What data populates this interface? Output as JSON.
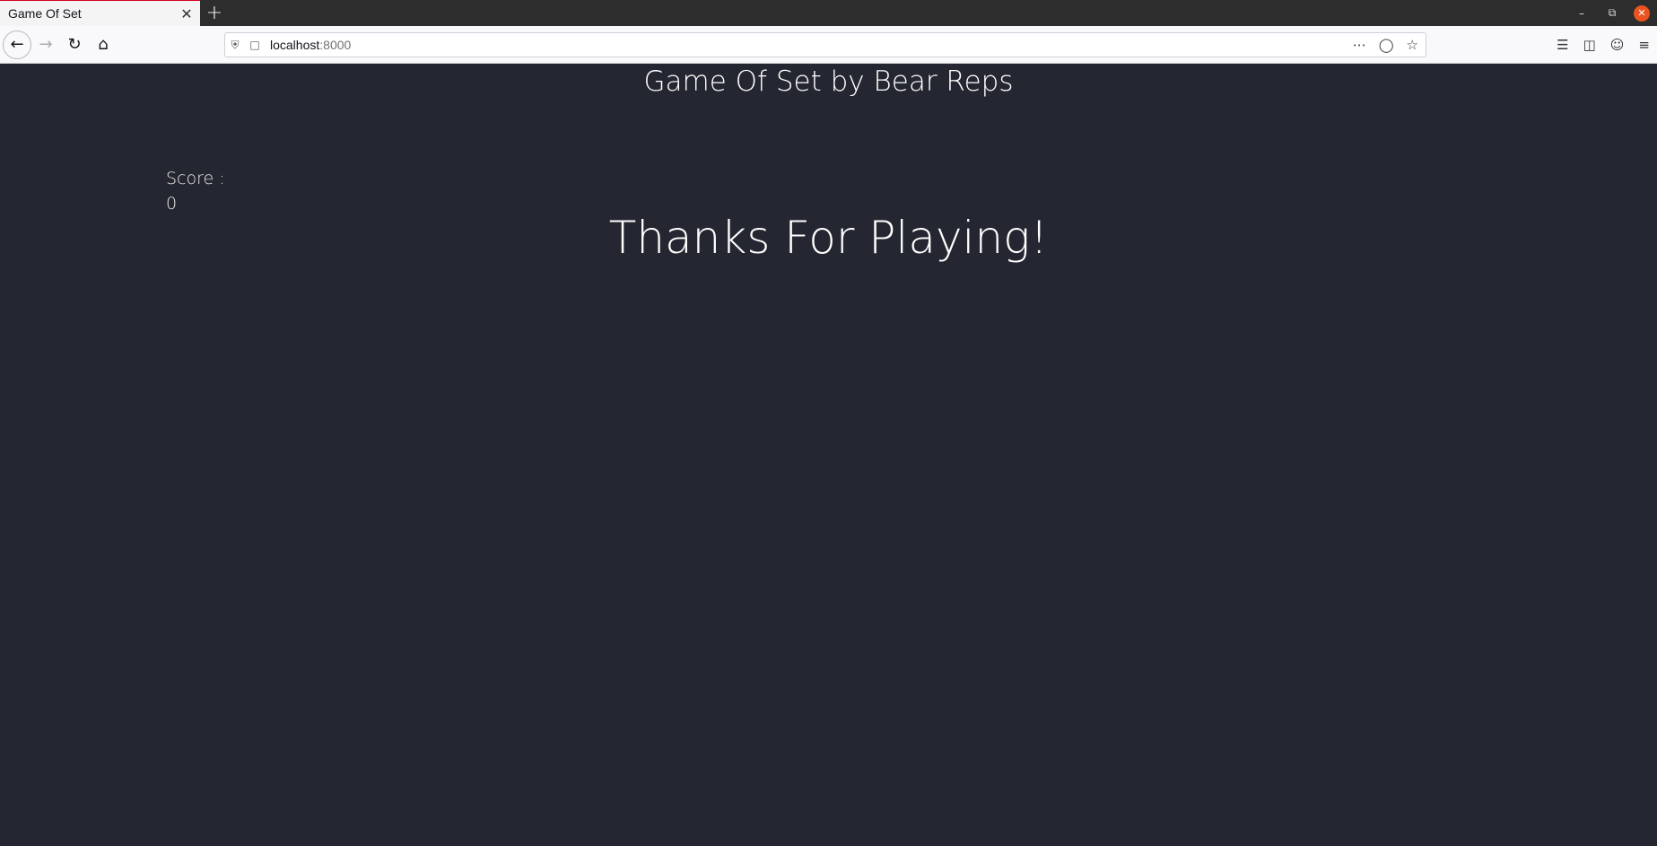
{
  "browser": {
    "tab_title": "Game Of Set",
    "tab_close": "✕",
    "new_tab": "+",
    "url_host": "localhost",
    "url_port": ":8000"
  },
  "page": {
    "title": "Game Of Set by Bear Reps",
    "score_label": "Score :",
    "score_value": "0",
    "message": "Thanks For Playing!"
  }
}
